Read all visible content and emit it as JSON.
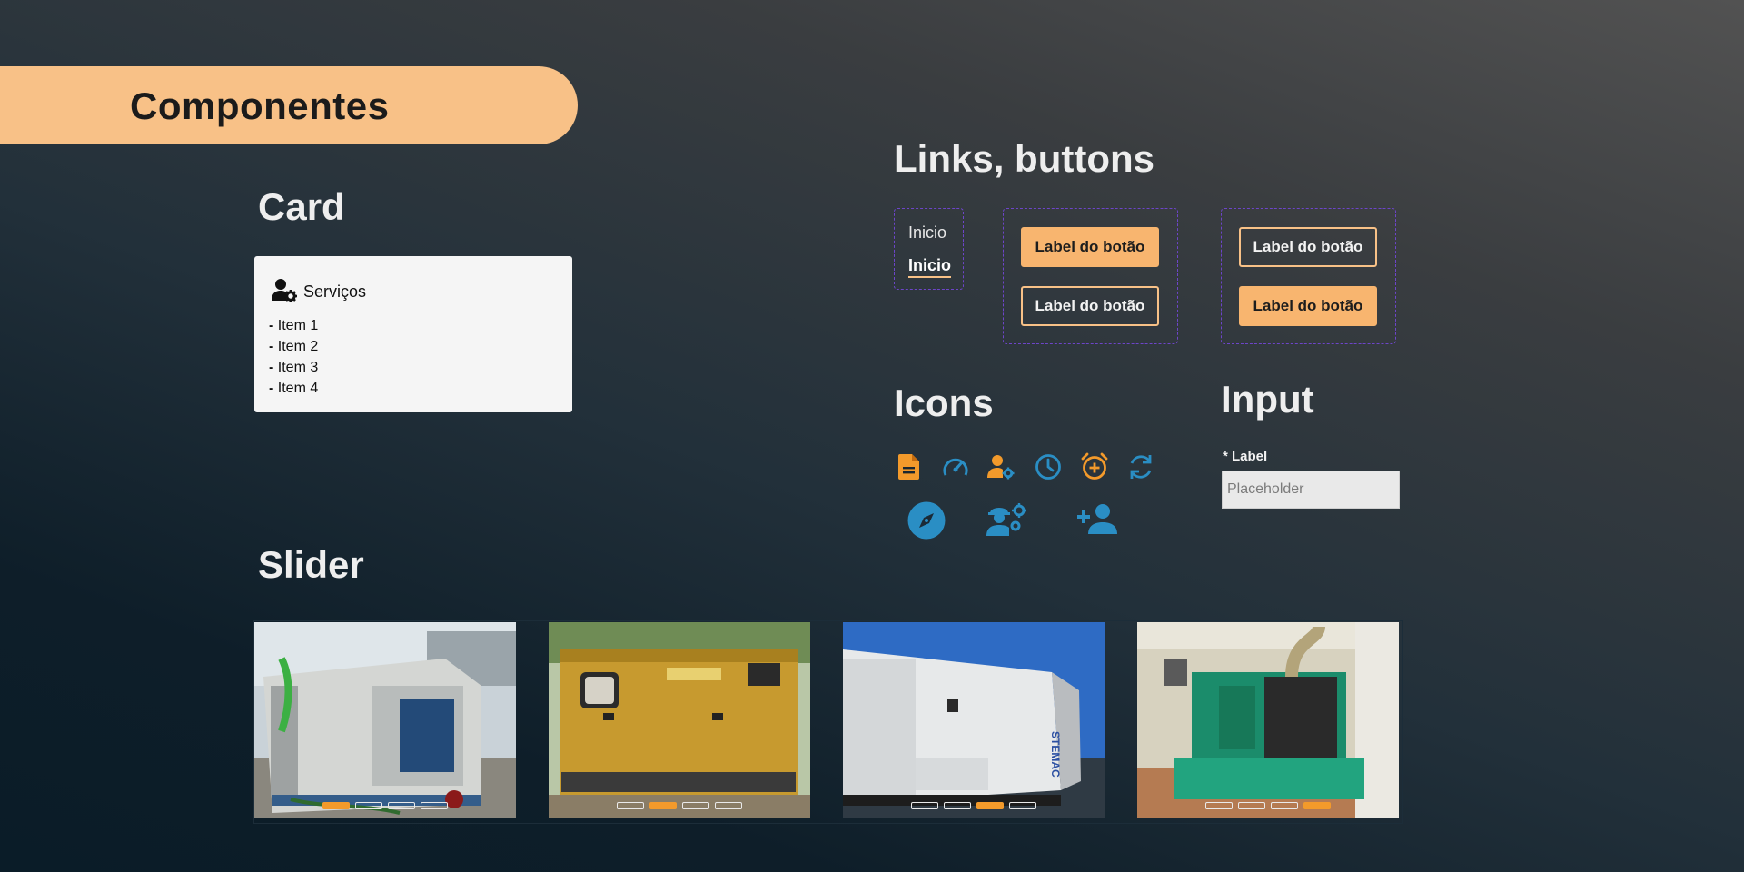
{
  "banner": {
    "title": "Componentes"
  },
  "card_section": {
    "title": "Card",
    "card": {
      "icon": "user-gear-icon",
      "title": "Serviços",
      "items": [
        "Item 1",
        "Item 2",
        "Item 3",
        "Item 4"
      ]
    }
  },
  "links_section": {
    "title": "Links, buttons",
    "links": [
      "Inicio",
      "Inicio"
    ],
    "buttons_group_1": [
      "Label do botão",
      "Label do botão"
    ],
    "buttons_group_2": [
      "Label do botão",
      "Label do botão"
    ]
  },
  "icons_section": {
    "title": "Icons",
    "icons": [
      "file-icon",
      "speedometer-icon",
      "user-gear-icon",
      "clock-icon",
      "alarm-add-icon",
      "sync-icon",
      "compass-icon",
      "worker-gear-icon",
      "add-user-icon"
    ]
  },
  "input_section": {
    "title": "Input",
    "label": "* Label",
    "placeholder": "Placeholder"
  },
  "slider_section": {
    "title": "Slider",
    "slides": [
      {
        "subject": "generator-white-open",
        "active_dot": 1
      },
      {
        "subject": "generator-yellow-cat",
        "active_dot": 2
      },
      {
        "subject": "generator-white-blue-sky",
        "active_dot": 3
      },
      {
        "subject": "generator-green-indoor",
        "active_dot": 4
      }
    ],
    "dots_per_slide": 4
  },
  "colors": {
    "accent": "#f8c187",
    "button": "#f8b56f",
    "dot_active": "#f39a2b",
    "icon_orange": "#f39a2b",
    "icon_blue": "#2a8ec4",
    "dashed_border": "#6d45c9"
  }
}
